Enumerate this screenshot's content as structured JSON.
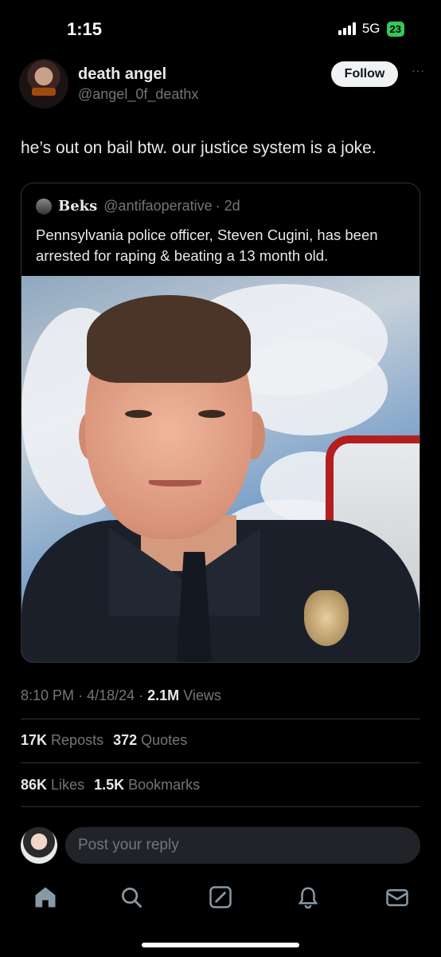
{
  "status_bar": {
    "time": "1:15",
    "network": "5G",
    "battery": "23"
  },
  "post": {
    "author_name": "death angel",
    "author_handle": "@angel_0f_deathx",
    "follow_label": "Follow",
    "more_label": "···",
    "text": "he’s out on bail btw. our justice system is a joke.",
    "quote": {
      "name": "Beks",
      "handle": "@antifaoperative",
      "age": "· 2d",
      "text": "Pennsylvania police officer, Steven Cugini, has been arrested for raping & beating a 13 month old."
    },
    "time": "8:10 PM",
    "date": "4/18/24",
    "views_count": "2.1M",
    "views_label": "Views",
    "reposts_count": "17K",
    "reposts_label": "Reposts",
    "quotes_count": "372",
    "quotes_label": "Quotes",
    "likes_count": "86K",
    "likes_label": "Likes",
    "bookmarks_count": "1.5K",
    "bookmarks_label": "Bookmarks"
  },
  "reply": {
    "placeholder": "Post your reply"
  },
  "tabbar": {
    "icons": [
      "home-icon",
      "search-icon",
      "grok-icon",
      "bell-icon",
      "mail-icon"
    ]
  },
  "colors": {
    "background": "#000000",
    "text": "#e7e9ea",
    "muted": "#71767b",
    "divider": "#2f3336",
    "battery": "#34c759"
  }
}
